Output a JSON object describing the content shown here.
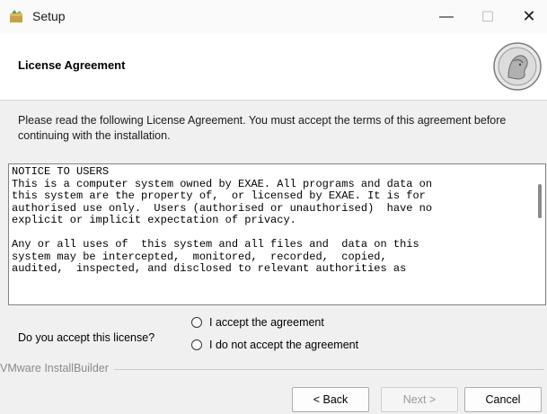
{
  "window": {
    "title": "Setup",
    "controls": {
      "minimize": "—",
      "maximize": "☐",
      "close": "✕"
    }
  },
  "header": {
    "title": "License Agreement"
  },
  "intro": "Please read the following License Agreement. You must accept the terms of this agreement before continuing with the installation.",
  "license": {
    "text": "NOTICE TO USERS\nThis is a computer system owned by EXAE. All programs and data on\nthis system are the property of,  or licensed by EXAE. It is for\nauthorised use only.  Users (authorised or unauthorised)  have no\nexplicit or implicit expectation of privacy.\n\nAny or all uses of  this system and all files and  data on this\nsystem may be intercepted,  monitored,  recorded,  copied,\naudited,  inspected, and disclosed to relevant authorities as"
  },
  "acceptance": {
    "question": "Do you accept this license?",
    "options": [
      "I accept the agreement",
      "I do not accept the agreement"
    ]
  },
  "footer": {
    "builder": "VMware InstallBuilder",
    "back": "< Back",
    "next": "Next >",
    "cancel": "Cancel"
  },
  "icons": {
    "app": "setup-app-icon",
    "logo": "coin-logo-icon"
  }
}
